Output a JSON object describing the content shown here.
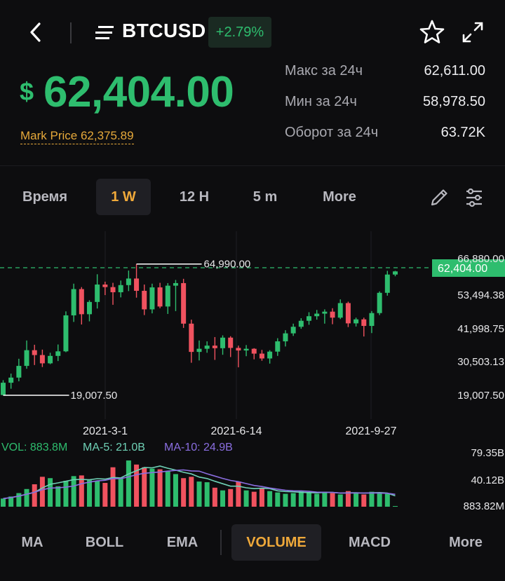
{
  "header": {
    "symbol": "BTCUSD",
    "change": "+2.79%",
    "icons": [
      "back-arrow-icon",
      "menu-icon",
      "star-icon",
      "expand-icon"
    ]
  },
  "price": {
    "currency": "$",
    "value": "62,404.00",
    "mark_price": "Mark Price 62,375.89"
  },
  "stats": [
    {
      "label": "Макс за 24ч",
      "value": "62,611.00"
    },
    {
      "label": "Мин за 24ч",
      "value": "58,978.50"
    },
    {
      "label": "Оборот за 24ч",
      "value": "63.72K"
    }
  ],
  "timeframes": {
    "items": [
      "Время",
      "1 W",
      "12 H",
      "5 m",
      "More"
    ],
    "active": "1 W"
  },
  "colors": {
    "up": "#2ebd6e",
    "down": "#f0525f",
    "accent": "#f0a93a",
    "ma5": "#6fd1b6",
    "ma10": "#8a6ee0"
  },
  "chart_data": {
    "type": "candlestick",
    "y_ticks": [
      "66,880.00",
      "53,494.38",
      "41,998.75",
      "30,503.13",
      "19,007.50"
    ],
    "x_labels": [
      "2021-3-1",
      "2021-6-14",
      "2021-9-27"
    ],
    "high_label": "64,990.00",
    "low_label": "19,007.50",
    "current_price_label": "62,404.00",
    "ylim": [
      19007.5,
      66880
    ],
    "candles": [
      {
        "o": 19100,
        "h": 24300,
        "l": 19007.5,
        "c": 23400
      },
      {
        "o": 23400,
        "h": 26600,
        "l": 21300,
        "c": 25200
      },
      {
        "o": 25200,
        "h": 31800,
        "l": 23900,
        "c": 29300
      },
      {
        "o": 29300,
        "h": 38200,
        "l": 28300,
        "c": 34800
      },
      {
        "o": 34800,
        "h": 36700,
        "l": 29600,
        "c": 33100
      },
      {
        "o": 33100,
        "h": 35000,
        "l": 28900,
        "c": 30200
      },
      {
        "o": 30200,
        "h": 33900,
        "l": 29900,
        "c": 32800
      },
      {
        "o": 32800,
        "h": 36800,
        "l": 31000,
        "c": 34400
      },
      {
        "o": 34400,
        "h": 48400,
        "l": 34100,
        "c": 47000
      },
      {
        "o": 47000,
        "h": 58100,
        "l": 44700,
        "c": 56200
      },
      {
        "o": 56200,
        "h": 56900,
        "l": 43800,
        "c": 47400
      },
      {
        "o": 47400,
        "h": 52300,
        "l": 44900,
        "c": 51700
      },
      {
        "o": 51700,
        "h": 61400,
        "l": 49400,
        "c": 57800
      },
      {
        "o": 57800,
        "h": 58800,
        "l": 54100,
        "c": 56900
      },
      {
        "o": 56900,
        "h": 58400,
        "l": 50700,
        "c": 55100
      },
      {
        "o": 55100,
        "h": 59200,
        "l": 53300,
        "c": 57600
      },
      {
        "o": 57600,
        "h": 62700,
        "l": 55500,
        "c": 59900
      },
      {
        "o": 59900,
        "h": 64990,
        "l": 53200,
        "c": 55600
      },
      {
        "o": 55600,
        "h": 57800,
        "l": 47100,
        "c": 49100
      },
      {
        "o": 49100,
        "h": 58100,
        "l": 47700,
        "c": 56800
      },
      {
        "o": 56800,
        "h": 58400,
        "l": 49500,
        "c": 50100
      },
      {
        "o": 50100,
        "h": 58300,
        "l": 47500,
        "c": 57400
      },
      {
        "o": 57400,
        "h": 59400,
        "l": 48500,
        "c": 58300
      },
      {
        "o": 58300,
        "h": 59800,
        "l": 42600,
        "c": 44100
      },
      {
        "o": 44100,
        "h": 45500,
        "l": 30400,
        "c": 34200
      },
      {
        "o": 34200,
        "h": 38200,
        "l": 31200,
        "c": 35300
      },
      {
        "o": 35300,
        "h": 37900,
        "l": 33900,
        "c": 36400
      },
      {
        "o": 36400,
        "h": 39400,
        "l": 31400,
        "c": 35500
      },
      {
        "o": 35500,
        "h": 40000,
        "l": 33200,
        "c": 39200
      },
      {
        "o": 39200,
        "h": 39700,
        "l": 32400,
        "c": 35600
      },
      {
        "o": 35600,
        "h": 36400,
        "l": 28800,
        "c": 34700
      },
      {
        "o": 34700,
        "h": 36600,
        "l": 32700,
        "c": 35300
      },
      {
        "o": 35300,
        "h": 35500,
        "l": 31600,
        "c": 33600
      },
      {
        "o": 33600,
        "h": 34900,
        "l": 31100,
        "c": 31900
      },
      {
        "o": 31900,
        "h": 34800,
        "l": 30100,
        "c": 34300
      },
      {
        "o": 34300,
        "h": 39000,
        "l": 32800,
        "c": 37900
      },
      {
        "o": 37900,
        "h": 41800,
        "l": 36100,
        "c": 40700
      },
      {
        "o": 40700,
        "h": 44100,
        "l": 39800,
        "c": 43000
      },
      {
        "o": 43000,
        "h": 46000,
        "l": 42300,
        "c": 45100
      },
      {
        "o": 45100,
        "h": 48100,
        "l": 43700,
        "c": 46700
      },
      {
        "o": 46700,
        "h": 48900,
        "l": 45500,
        "c": 47600
      },
      {
        "o": 47600,
        "h": 49100,
        "l": 44100,
        "c": 48300
      },
      {
        "o": 48300,
        "h": 49500,
        "l": 43900,
        "c": 46200
      },
      {
        "o": 46200,
        "h": 52600,
        "l": 45700,
        "c": 51300
      },
      {
        "o": 51300,
        "h": 51800,
        "l": 42900,
        "c": 44200
      },
      {
        "o": 44200,
        "h": 46200,
        "l": 43100,
        "c": 45600
      },
      {
        "o": 45600,
        "h": 46200,
        "l": 39600,
        "c": 43300
      },
      {
        "o": 43300,
        "h": 48500,
        "l": 40800,
        "c": 47800
      },
      {
        "o": 47800,
        "h": 55400,
        "l": 47100,
        "c": 54900
      },
      {
        "o": 54900,
        "h": 62600,
        "l": 53900,
        "c": 61300
      },
      {
        "o": 61300,
        "h": 62600,
        "l": 60700,
        "c": 62404
      }
    ]
  },
  "volume_data": {
    "vol_label": "VOL: 883.8M",
    "ma5_label": "MA-5: 21.0B",
    "ma10_label": "MA-10: 24.9B",
    "y_ticks": [
      "79.35B",
      "40.12B",
      "883.82M"
    ],
    "ylim": [
      0,
      79.35
    ],
    "values": [
      12,
      15,
      20,
      26,
      33,
      44,
      42,
      30,
      38,
      45,
      46,
      39,
      38,
      35,
      58,
      42,
      68,
      62,
      58,
      56,
      55,
      52,
      48,
      42,
      44,
      37,
      36,
      28,
      24,
      26,
      37,
      24,
      22,
      27,
      23,
      21,
      19,
      20,
      23,
      21,
      19,
      22,
      20,
      18,
      23,
      21,
      18,
      22,
      20,
      19,
      1
    ],
    "ma5": [
      12,
      13.5,
      15.7,
      18.3,
      21.2,
      27.6,
      33,
      35,
      37.4,
      39.8,
      40.2,
      39.6,
      41.2,
      40.6,
      43,
      42.4,
      48.2,
      53,
      57.6,
      57.2,
      59.8,
      56.6,
      53.8,
      50.6,
      48.2,
      43.6,
      41.4,
      37.4,
      33.8,
      30.2,
      30.2,
      27.8,
      26.6,
      27.2,
      26.6,
      23.4,
      22.4,
      22,
      21.2,
      20.8,
      20.4,
      21,
      21,
      20,
      20.4,
      20.6,
      20,
      20.4,
      20.8,
      20,
      16
    ],
    "ma10": [
      12,
      13.5,
      15.7,
      18.3,
      21.2,
      25,
      27.4,
      27.8,
      28.8,
      30.4,
      33.8,
      36.2,
      38,
      38.9,
      41.4,
      41.3,
      43.9,
      47.1,
      49.2,
      50.2,
      51.1,
      52.4,
      53.4,
      54.1,
      52.7,
      52.2,
      48.4,
      45,
      41.6,
      38.6,
      36.8,
      34,
      31.2,
      29.7,
      27.5,
      25.9,
      24.2,
      23.4,
      23.3,
      22.6,
      21.4,
      21.2,
      21.1,
      20.2,
      20.2,
      20.2,
      20.2,
      20.3,
      20,
      19.8,
      18.2
    ]
  },
  "indicators": {
    "items": [
      "MA",
      "BOLL",
      "EMA",
      "VOLUME",
      "MACD",
      "More"
    ],
    "active": "VOLUME"
  }
}
